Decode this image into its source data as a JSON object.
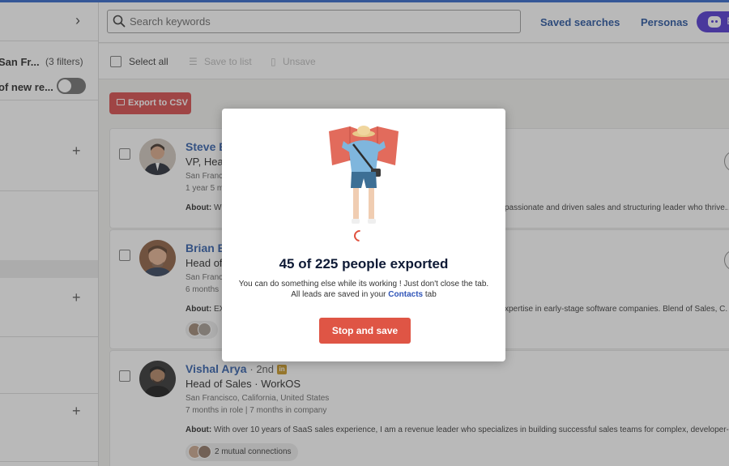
{
  "sidebar": {
    "location_label": "San Fr...",
    "filters_count": "(3 filters)",
    "new_results_label": "of new re..."
  },
  "header": {
    "search_placeholder": "Search keywords",
    "saved_searches": "Saved searches",
    "personas": "Personas",
    "assistant_label": "B"
  },
  "toolbar": {
    "select_all": "Select all",
    "save_to_list": "Save to list",
    "unsave": "Unsave",
    "export_csv": "Export to CSV"
  },
  "leads": [
    {
      "name": "Steve B",
      "title": "VP, Head",
      "location": "San Francisco",
      "tenure": "1 year 5 m",
      "about_label": "About:",
      "about_start": "Wi",
      "about_tail": "passionate and driven sales and structuring leader who thrive..."
    },
    {
      "name": "Brian B",
      "title": "Head of",
      "location": "San Francisco",
      "tenure": "6 months",
      "about_label": "About:",
      "about_start": "EX",
      "about_tail": "xpertise in early-stage software companies. Blend of Sales, C..."
    },
    {
      "name": "Vishal Arya",
      "degree": "· 2nd",
      "title": "Head of Sales · WorkOS",
      "location": "San Francisco, California, United States",
      "tenure": "7 months in role | 7 months in company",
      "about_label": "About:",
      "about_start": "With over 10 years of SaaS sales experience, I am a revenue leader who specializes in building successful sales teams for complex, developer-le...",
      "mutual": "2 mutual connections"
    }
  ],
  "modal": {
    "title": "45 of 225 people exported",
    "line1": "You can do something else while its working ! Just don't close the tab.",
    "line2_prefix": "All leads are saved in your",
    "line2_link": "Contacts",
    "line2_suffix": "tab",
    "stop_button": "Stop and save"
  },
  "colors": {
    "accent_blue": "#1f4e9c",
    "export_red": "#d64545",
    "stop_red": "#df5545",
    "assistant_purple": "#4b2fd1"
  }
}
